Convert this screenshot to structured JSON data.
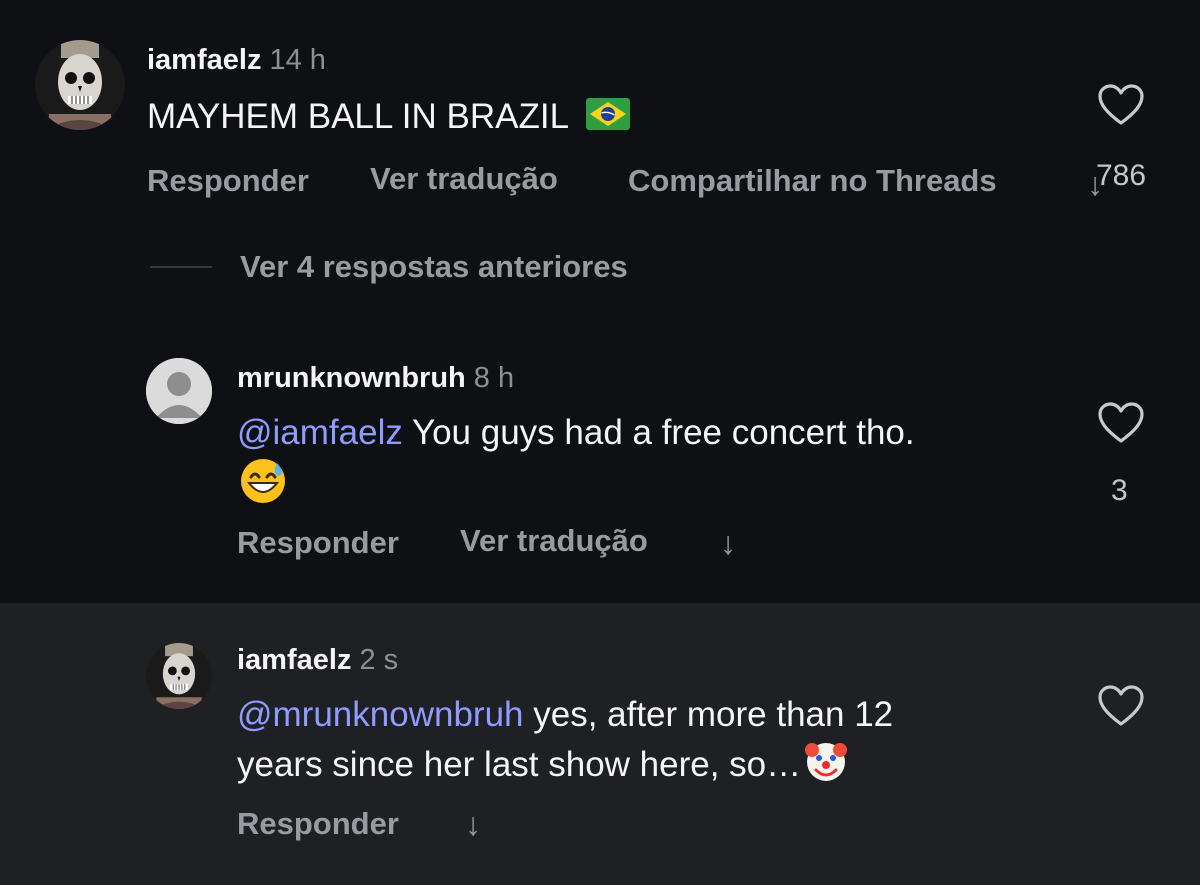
{
  "comments": [
    {
      "username": "iamfaelz",
      "time": "14 h",
      "text": "MAYHEM BALL IN BRAZIL",
      "emoji": "🇧🇷",
      "actions": [
        "Responder",
        "Ver tradução",
        "Compartilhar no Threads"
      ],
      "likes": "786"
    },
    {
      "username": "mrunknownbruh",
      "time": "8 h",
      "mention": "@iamfaelz",
      "text": " You guys had a free concert tho.",
      "emoji": "😅",
      "actions": [
        "Responder",
        "Ver tradução"
      ],
      "likes": "3"
    },
    {
      "username": "iamfaelz",
      "time": "2 s",
      "mention": "@mrunknownbruh",
      "text_line1": " yes, after more than 12",
      "text_line2": "years since her last show here, so…",
      "emoji": "🤡",
      "actions": [
        "Responder"
      ]
    }
  ],
  "replies_toggle": "Ver 4 respostas anteriores",
  "icons": [
    "heart-icon",
    "arrow-down-icon",
    "avatar-skull",
    "avatar-default"
  ]
}
